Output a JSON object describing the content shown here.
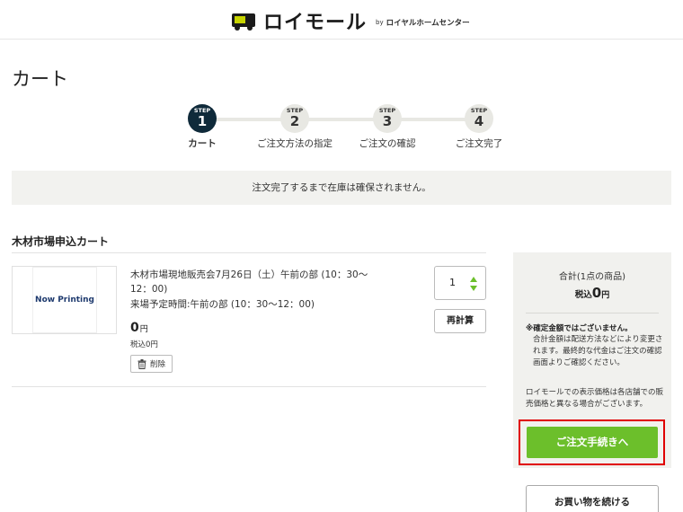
{
  "header": {
    "logo_text": "ロイモール",
    "by_text": "by",
    "sub_brand": "ロイヤルホームセンター"
  },
  "page_title": "カート",
  "steps": [
    {
      "step_label": "STEP",
      "number": "1",
      "label": "カート",
      "active": true
    },
    {
      "step_label": "STEP",
      "number": "2",
      "label": "ご注文方法の指定",
      "active": false
    },
    {
      "step_label": "STEP",
      "number": "3",
      "label": "ご注文の確認",
      "active": false
    },
    {
      "step_label": "STEP",
      "number": "4",
      "label": "ご注文完了",
      "active": false
    }
  ],
  "notice": "注文完了するまで在庫は確保されません。",
  "cart": {
    "title": "木材市場申込カート",
    "item": {
      "image_text": "Now Printing",
      "name": "木材市場現地販売会7月26日（土）午前の部 (10：30〜12：00)",
      "schedule": "来場予定時間:午前の部 (10：30〜12：00)",
      "price": "0",
      "price_unit": "円",
      "tax_note": "税込0円",
      "delete_label": "削除",
      "quantity": "1",
      "recalc_label": "再計算"
    }
  },
  "summary": {
    "label": "合計(1点の商品)",
    "tax_prefix": "税込",
    "total": "0",
    "unit": "円",
    "note_title": "※確定金額ではございません。",
    "note_body": "合計金額は配送方法などにより変更されます。最終的な代金はご注文の確認画面よりご確認ください。",
    "note2": "ロイモールでの表示価格は各店舗での販売価格と異なる場合がございます。",
    "checkout_label": "ご注文手続きへ",
    "continue_label": "お買い物を続ける"
  },
  "colors": {
    "accent_green": "#6cbf2b",
    "step_active": "#0f2a3a",
    "highlight_red": "#e00000"
  }
}
